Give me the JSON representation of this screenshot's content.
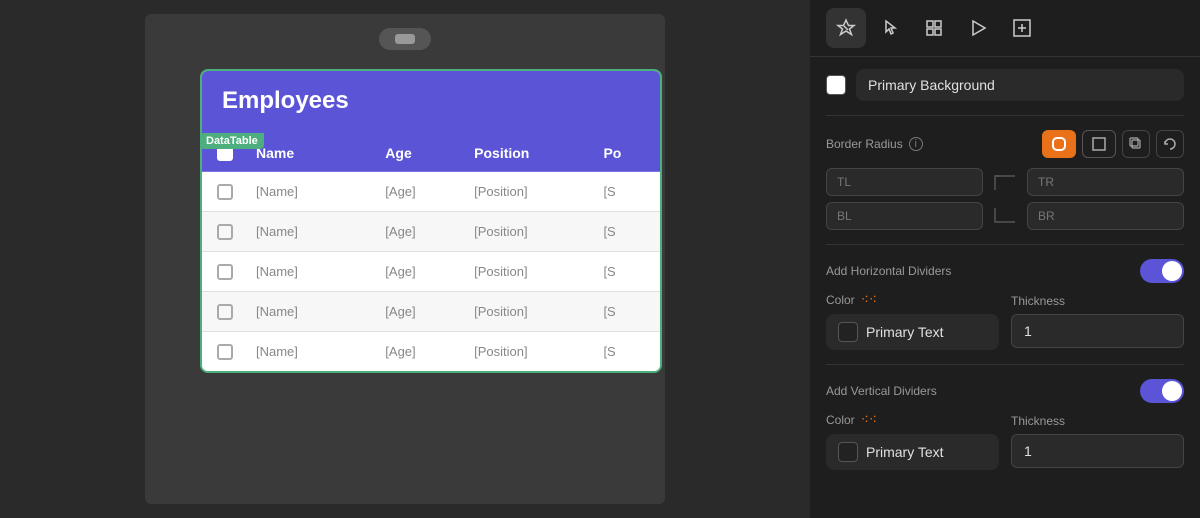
{
  "toolbar": {
    "icons": [
      {
        "name": "design-icon",
        "symbol": "✦",
        "active": true
      },
      {
        "name": "pointer-icon",
        "symbol": "⤷",
        "active": false
      },
      {
        "name": "layout-icon",
        "symbol": "⊞",
        "active": false
      },
      {
        "name": "play-icon",
        "symbol": "▶",
        "active": false
      },
      {
        "name": "add-frame-icon",
        "symbol": "⊡",
        "active": false
      }
    ]
  },
  "primary_background": {
    "label": "Primary Background",
    "swatch_color": "white"
  },
  "border_radius": {
    "label": "Border Radius",
    "info": true,
    "active_btn": "rounded-all",
    "corners": {
      "tl": {
        "label": "TL",
        "value": ""
      },
      "tr": {
        "label": "TR",
        "value": ""
      },
      "bl": {
        "label": "BL",
        "value": ""
      },
      "br": {
        "label": "BR",
        "value": ""
      }
    }
  },
  "horizontal_dividers": {
    "label": "Add Horizontal Dividers",
    "enabled": true,
    "color_label": "Color",
    "color_text": "Primary Text",
    "thickness_label": "Thickness",
    "thickness_value": "1"
  },
  "vertical_dividers": {
    "label": "Add Vertical Dividers",
    "enabled": true,
    "color_label": "Color",
    "color_text": "Primary Text",
    "thickness_label": "Thickness",
    "thickness_value": "1"
  },
  "datatable": {
    "title": "Employees",
    "tag": "DataTable",
    "columns": [
      "Name",
      "Age",
      "Position",
      "Po"
    ],
    "rows": [
      {
        "name": "[Name]",
        "age": "[Age]",
        "position": "[Position]",
        "extra": "[S"
      },
      {
        "name": "[Name]",
        "age": "[Age]",
        "position": "[Position]",
        "extra": "[S"
      },
      {
        "name": "[Name]",
        "age": "[Age]",
        "position": "[Position]",
        "extra": "[S"
      },
      {
        "name": "[Name]",
        "age": "[Age]",
        "position": "[Position]",
        "extra": "[S"
      },
      {
        "name": "[Name]",
        "age": "[Age]",
        "position": "[Position]",
        "extra": "[S"
      }
    ]
  },
  "pill_button": {
    "label": "——"
  }
}
